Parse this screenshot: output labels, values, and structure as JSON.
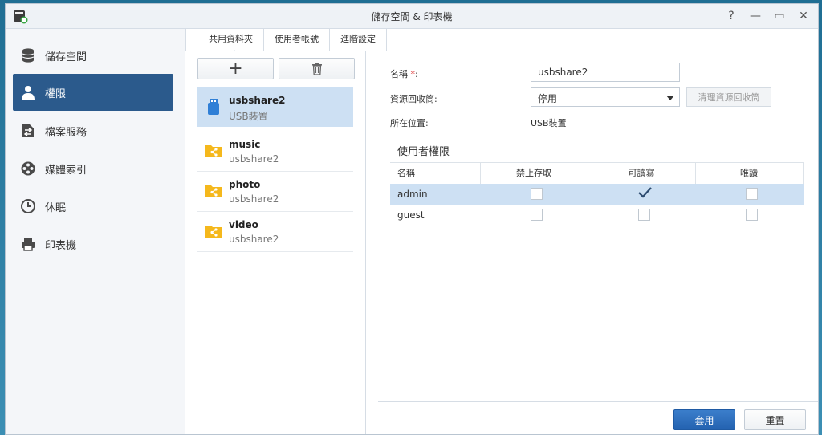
{
  "window": {
    "title": "儲存空間 & 印表機",
    "controls": {
      "help": "?",
      "minimize": "—",
      "maximize": "▭",
      "close": "✕"
    }
  },
  "sidebar": {
    "items": [
      {
        "label": "儲存空間",
        "icon": "database-icon"
      },
      {
        "label": "權限",
        "icon": "user-icon",
        "active": true
      },
      {
        "label": "檔案服務",
        "icon": "file-transfer-icon"
      },
      {
        "label": "媒體索引",
        "icon": "film-reel-icon"
      },
      {
        "label": "休眠",
        "icon": "clock-icon"
      },
      {
        "label": "印表機",
        "icon": "printer-icon"
      }
    ]
  },
  "tabs": [
    {
      "label": "共用資料夾",
      "active": true
    },
    {
      "label": "使用者帳號"
    },
    {
      "label": "進階設定"
    }
  ],
  "toolbar": {
    "add": "+",
    "delete": "trash-icon"
  },
  "shares": [
    {
      "name": "usbshare2",
      "sub": "USB裝置",
      "icon": "usb-drive-icon",
      "selected": true
    },
    {
      "name": "music",
      "sub": "usbshare2",
      "icon": "shared-folder-icon"
    },
    {
      "name": "photo",
      "sub": "usbshare2",
      "icon": "shared-folder-icon"
    },
    {
      "name": "video",
      "sub": "usbshare2",
      "icon": "shared-folder-icon"
    }
  ],
  "detail": {
    "name_label": "名稱",
    "required_mark": "*",
    "name_colon": ":",
    "name_value": "usbshare2",
    "recycle_label": "資源回收筒:",
    "recycle_value": "停用",
    "recycle_clear": "清理資源回收筒",
    "location_label": "所在位置:",
    "location_value": "USB裝置",
    "permissions_title": "使用者權限",
    "columns": [
      "名稱",
      "禁止存取",
      "可讀寫",
      "唯讀"
    ],
    "rows": [
      {
        "user": "admin",
        "deny": false,
        "rw": true,
        "ro": false,
        "selected": true
      },
      {
        "user": "guest",
        "deny": false,
        "rw": false,
        "ro": false
      }
    ]
  },
  "actions": {
    "apply": "套用",
    "reset": "重置"
  },
  "colors": {
    "accent": "#2b5a8c",
    "selection": "#cde0f3",
    "primary_button": "#2d6dbf",
    "folder": "#f5b81c",
    "usb": "#2f7fd6"
  }
}
